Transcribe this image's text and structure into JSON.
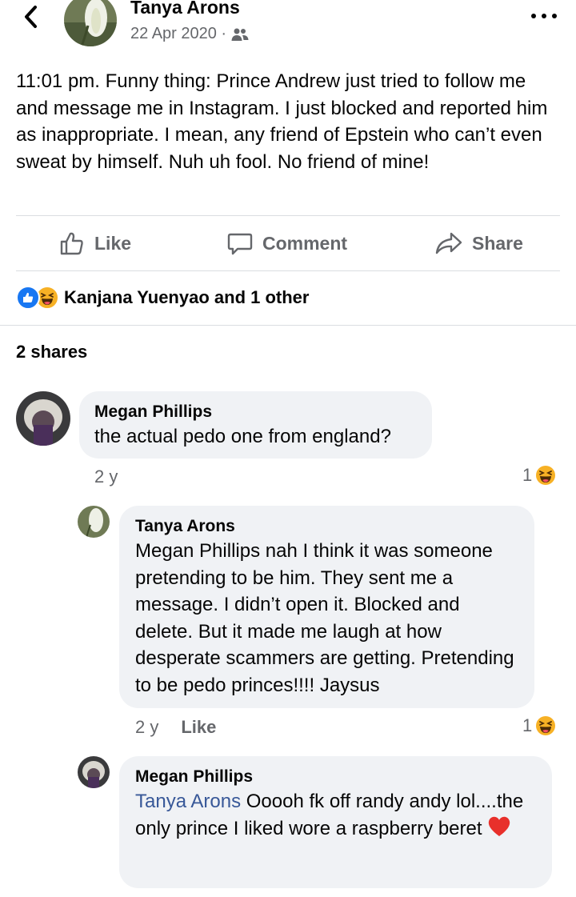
{
  "header": {
    "author_name": "Tanya Arons",
    "date": "22 Apr 2020 ·",
    "audience_icon": "friends-icon",
    "back_icon": "chevron-left-icon",
    "more_icon": "more-horizontal-icon"
  },
  "post": {
    "text": "11:01 pm. Funny thing: Prince Andrew just tried to follow me and message me in Instagram.  I just blocked and reported him as inappropriate.  I mean, any friend of Epstein who can’t even sweat by himself.  Nuh uh fool.  No friend of mine!"
  },
  "actions": {
    "like": "Like",
    "comment": "Comment",
    "share": "Share"
  },
  "reactions": {
    "icons": [
      "like-reaction-icon",
      "haha-reaction-icon"
    ],
    "summary": "Kanjana Yuenyao and 1 other"
  },
  "shares": "2 shares",
  "comments": [
    {
      "name": "Megan Phillips",
      "text": "the actual pedo one from england?",
      "time": "2 y",
      "reaction_count": "1",
      "reaction_icon": "haha-reaction-icon"
    },
    {
      "name": "Tanya Arons",
      "text": "Megan Phillips nah I think it was someone pretending to be him.  They sent me a message.  I didn’t open it.  Blocked and delete.  But it made me laugh at how desperate scammers are getting.  Pretending to be pedo princes!!!!  Jaysus",
      "time": "2 y",
      "like_label": "Like",
      "reaction_count": "1",
      "reaction_icon": "haha-reaction-icon"
    },
    {
      "name": "Megan Phillips",
      "mention": "Tanya Arons",
      "text": " Ooooh fk off randy andy lol....the only prince I liked wore a raspberry beret ",
      "emoji_icon": "red-heart-icon"
    }
  ],
  "colors": {
    "text": "#050505",
    "secondary": "#65676b",
    "bubble": "#f0f2f5",
    "link": "#385898",
    "like_blue": "#1877f2",
    "haha_yellow": "#f7b125",
    "heart_red": "#e8302b"
  }
}
